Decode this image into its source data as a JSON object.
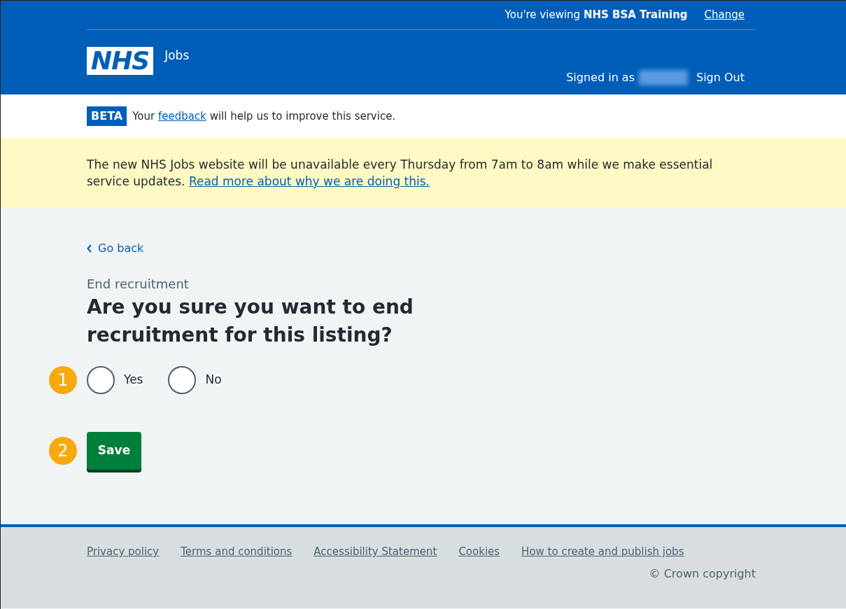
{
  "header": {
    "viewing_prefix": "You're viewing",
    "organisation": "NHS BSA Training",
    "change_link": "Change",
    "logo": "NHS",
    "service": "Jobs",
    "signed_in_label": "Signed in as",
    "sign_out": "Sign Out"
  },
  "phase_banner": {
    "tag": "BETA",
    "before": "Your",
    "link": "feedback",
    "after": "will help us to improve this service."
  },
  "notice": {
    "text": "The new NHS Jobs website will be unavailable every Thursday from 7am to 8am while we make essential service updates.",
    "link": "Read more about why we are doing this."
  },
  "back_link": "Go back",
  "caption": "End recruitment",
  "heading": "Are you sure you want to end recruitment for this listing?",
  "radios": [
    {
      "label": "Yes",
      "selected": false
    },
    {
      "label": "No",
      "selected": false
    }
  ],
  "save_button": "Save",
  "callouts": [
    "1",
    "2"
  ],
  "footer": {
    "links": [
      "Privacy policy",
      "Terms and conditions",
      "Accessibility Statement",
      "Cookies",
      "How to create and publish jobs"
    ],
    "copyright": "© Crown copyright"
  }
}
